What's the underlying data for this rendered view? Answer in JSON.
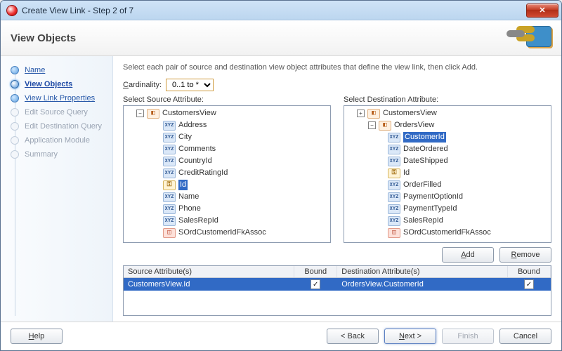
{
  "window": {
    "title": "Create View Link - Step 2 of 7"
  },
  "header": {
    "title": "View Objects"
  },
  "nav": {
    "items": [
      {
        "label": "Name",
        "state": "done"
      },
      {
        "label": "View Objects",
        "state": "active"
      },
      {
        "label": "View Link Properties",
        "state": "done"
      },
      {
        "label": "Edit Source Query",
        "state": "future"
      },
      {
        "label": "Edit Destination Query",
        "state": "future"
      },
      {
        "label": "Application Module",
        "state": "future"
      },
      {
        "label": "Summary",
        "state": "future"
      }
    ]
  },
  "main": {
    "instruction": "Select each pair of source and destination view object attributes that define the view link, then click Add.",
    "cardinality_label_prefix": "C",
    "cardinality_label_rest": "ardinality:",
    "cardinality_value": "0..1 to *",
    "source_label": "Select Source Attribute:",
    "dest_label": "Select Destination Attribute:",
    "source_tree": {
      "parent_label": "CustomersView",
      "items": [
        {
          "icon": "xyz",
          "label": "Address"
        },
        {
          "icon": "xyz",
          "label": "City"
        },
        {
          "icon": "xyz",
          "label": "Comments"
        },
        {
          "icon": "xyz",
          "label": "CountryId"
        },
        {
          "icon": "xyz",
          "label": "CreditRatingId"
        },
        {
          "icon": "key",
          "label": "Id",
          "selected": true
        },
        {
          "icon": "xyz",
          "label": "Name"
        },
        {
          "icon": "xyz",
          "label": "Phone"
        },
        {
          "icon": "xyz",
          "label": "SalesRepId"
        },
        {
          "icon": "pkg-red",
          "label": "SOrdCustomerIdFkAssoc"
        }
      ]
    },
    "dest_tree": {
      "grandparent_label": "CustomersView",
      "parent_label": "OrdersView",
      "items": [
        {
          "icon": "xyz",
          "label": "CustomerId",
          "selected": true
        },
        {
          "icon": "xyz",
          "label": "DateOrdered"
        },
        {
          "icon": "xyz",
          "label": "DateShipped"
        },
        {
          "icon": "key",
          "label": "Id"
        },
        {
          "icon": "xyz",
          "label": "OrderFilled"
        },
        {
          "icon": "xyz",
          "label": "PaymentOptionId"
        },
        {
          "icon": "xyz",
          "label": "PaymentTypeId"
        },
        {
          "icon": "xyz",
          "label": "SalesRepId"
        },
        {
          "icon": "pkg-red",
          "label": "SOrdCustomerIdFkAssoc"
        }
      ]
    },
    "add_label": "Add",
    "remove_label": "Remove",
    "table": {
      "col_source": "Source Attribute(s)",
      "col_bound": "Bound",
      "col_dest": "Destination Attribute(s)",
      "rows": [
        {
          "source": "CustomersView.Id",
          "source_bound": true,
          "dest": "OrdersView.CustomerId",
          "dest_bound": true
        }
      ]
    }
  },
  "footer": {
    "help": "Help",
    "back": "< Back",
    "next": "Next >",
    "finish": "Finish",
    "cancel": "Cancel"
  }
}
